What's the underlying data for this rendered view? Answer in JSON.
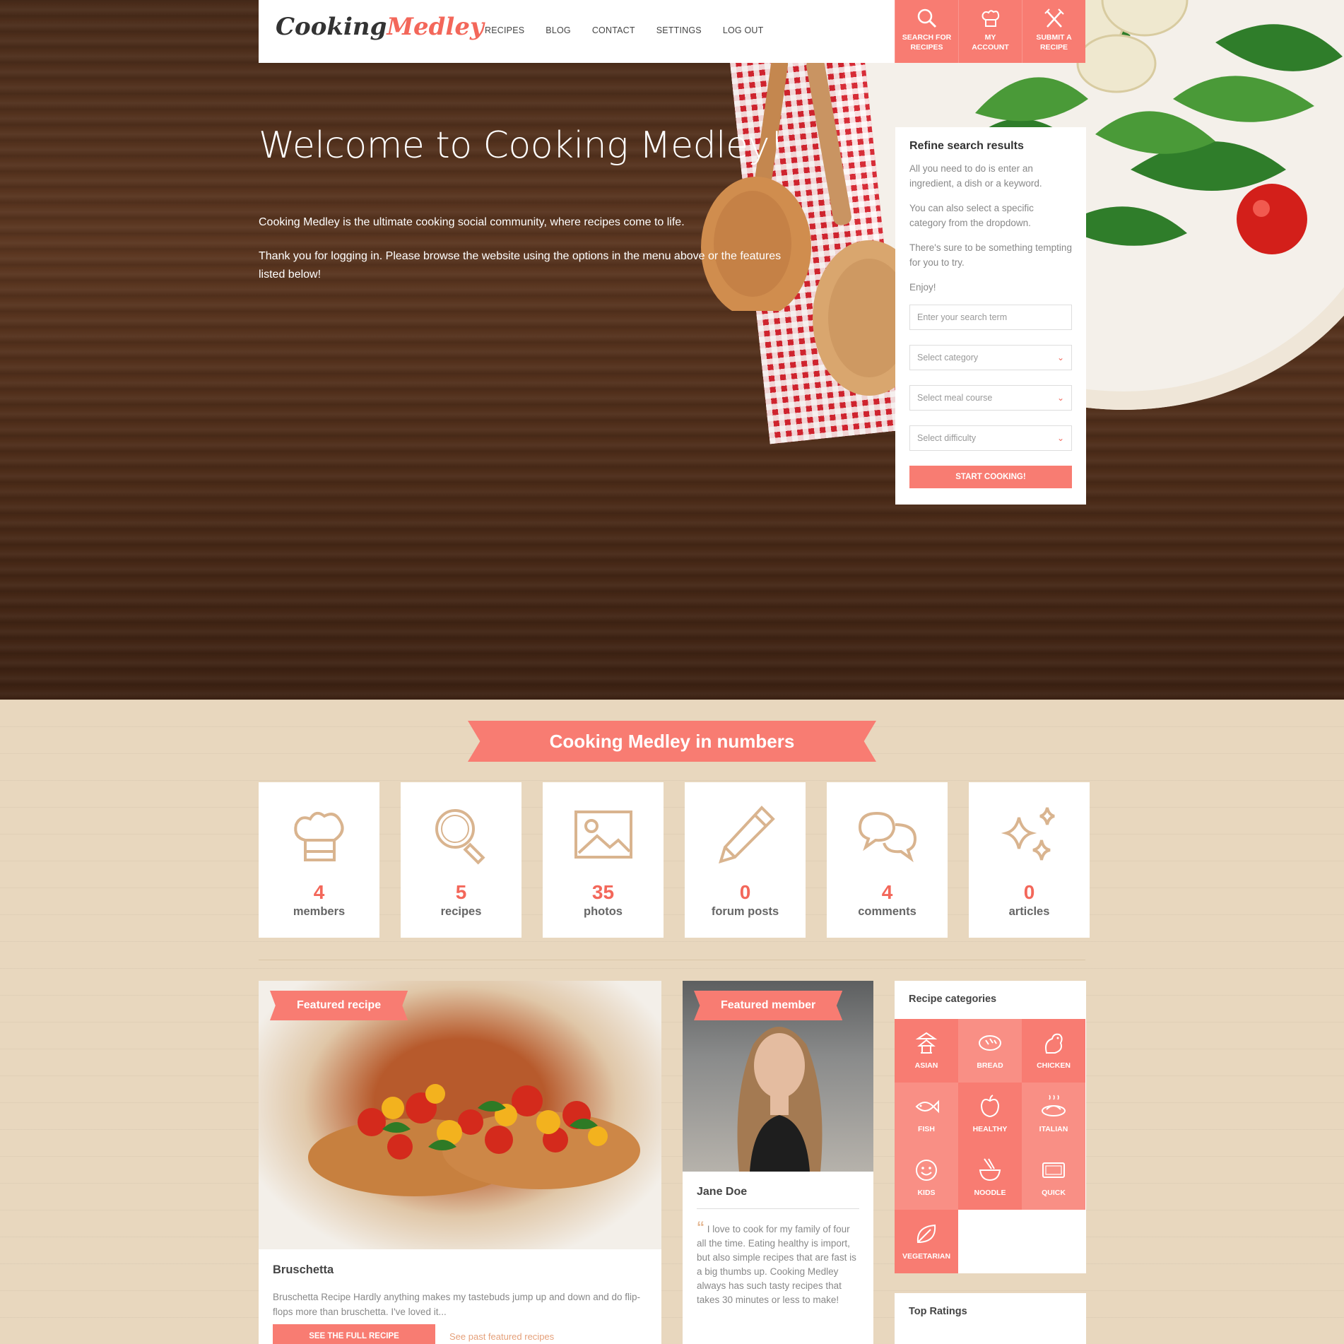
{
  "brand": {
    "part1": "Cooking",
    "part2": "Medley"
  },
  "nav": {
    "links": [
      "RECIPES",
      "BLOG",
      "CONTACT",
      "SETTINGS",
      "LOG OUT"
    ],
    "buttons": [
      {
        "label1": "SEARCH FOR",
        "label2": "RECIPES",
        "icon": "search-icon"
      },
      {
        "label1": "MY",
        "label2": "ACCOUNT",
        "icon": "chef-hat-icon"
      },
      {
        "label1": "SUBMIT A",
        "label2": "RECIPE",
        "icon": "fork-knife-icon"
      }
    ]
  },
  "hero": {
    "title": "Welcome to Cooking Medley!",
    "p1": "Cooking Medley is the ultimate cooking social community, where recipes come to life.",
    "p2": "Thank you for logging in. Please browse the website using the options in the menu above or the features listed below!"
  },
  "search": {
    "title": "Refine search results",
    "p1": "All you need to do is enter an ingredient, a dish or a keyword.",
    "p2": "You can also select a specific category from the dropdown.",
    "p3": "There's sure to be something tempting for you to try.",
    "p4": "Enjoy!",
    "term_placeholder": "Enter your search term",
    "category": "Select category",
    "meal_course": "Select meal course",
    "difficulty": "Select difficulty",
    "submit": "START COOKING!"
  },
  "numbers": {
    "title": "Cooking Medley in numbers",
    "stats": [
      {
        "num": "4",
        "label": "members",
        "icon": "chef-hat-icon"
      },
      {
        "num": "5",
        "label": "recipes",
        "icon": "search-icon"
      },
      {
        "num": "35",
        "label": "photos",
        "icon": "image-icon"
      },
      {
        "num": "0",
        "label": "forum posts",
        "icon": "pencil-icon"
      },
      {
        "num": "4",
        "label": "comments",
        "icon": "chat-bubbles-icon"
      },
      {
        "num": "0",
        "label": "articles",
        "icon": "sparkle-icon"
      }
    ]
  },
  "featured_recipe": {
    "tag": "Featured recipe",
    "title": "Bruschetta",
    "excerpt": "Bruschetta Recipe Hardly anything makes my tastebuds jump up and down and do flip-flops more than bruschetta. I've loved it...",
    "button": "SEE THE FULL RECIPE",
    "past_link": "See past featured recipes"
  },
  "featured_member": {
    "tag": "Featured member",
    "name": "Jane Doe",
    "quote": "I love to cook for my family of four all the time. Eating healthy is import, but also simple recipes that are fast is a big thumbs up. Cooking Medley always has such tasty recipes that takes 30 minutes or less to make!"
  },
  "categories": {
    "title": "Recipe categories",
    "items": [
      "ASIAN",
      "BREAD",
      "CHICKEN",
      "FISH",
      "HEALTHY",
      "ITALIAN",
      "KIDS",
      "NOODLE",
      "QUICK",
      "VEGETARIAN"
    ]
  },
  "top_ratings": {
    "title": "Top Ratings"
  },
  "colors": {
    "accent": "#f87c72",
    "accent_text": "#f3675a",
    "icon_tan": "#d9b48f"
  }
}
